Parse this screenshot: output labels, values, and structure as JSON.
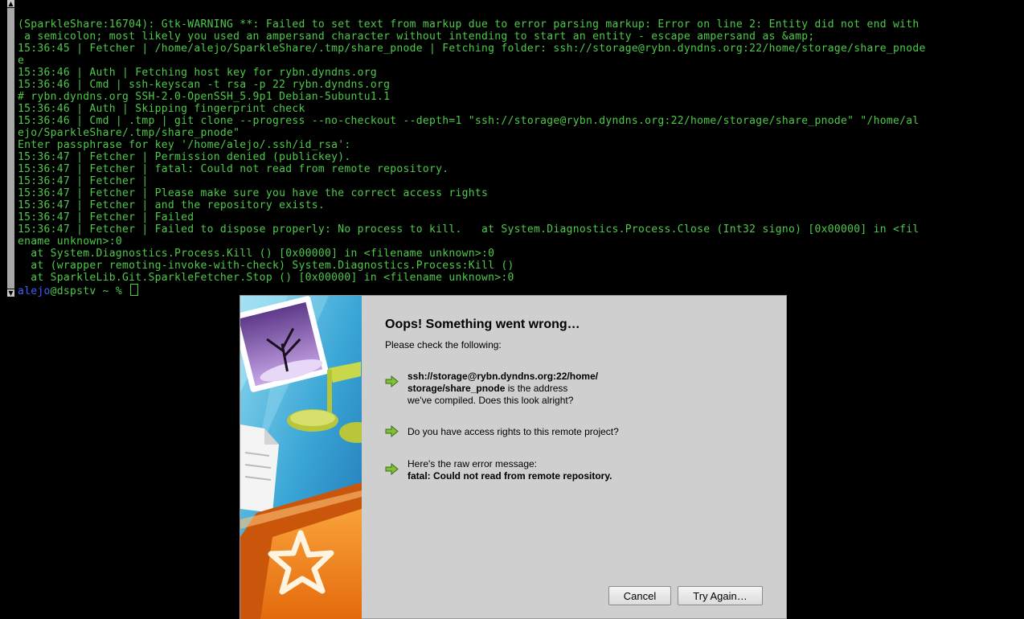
{
  "terminal": {
    "lines": [
      "(SparkleShare:16704): Gtk-WARNING **: Failed to set text from markup due to error parsing markup: Error on line 2: Entity did not end with",
      " a semicolon; most likely you used an ampersand character without intending to start an entity - escape ampersand as &amp;",
      "15:36:45 | Fetcher | /home/alejo/SparkleShare/.tmp/share_pnode | Fetching folder: ssh://storage@rybn.dyndns.org:22/home/storage/share_pnode",
      "e",
      "15:36:46 | Auth | Fetching host key for rybn.dyndns.org",
      "15:36:46 | Cmd | ssh-keyscan -t rsa -p 22 rybn.dyndns.org",
      "# rybn.dyndns.org SSH-2.0-OpenSSH_5.9p1 Debian-5ubuntu1.1",
      "15:36:46 | Auth | Skipping fingerprint check",
      "15:36:46 | Cmd | .tmp | git clone --progress --no-checkout --depth=1 \"ssh://storage@rybn.dyndns.org:22/home/storage/share_pnode\" \"/home/al",
      "ejo/SparkleShare/.tmp/share_pnode\"",
      "Enter passphrase for key '/home/alejo/.ssh/id_rsa':",
      "15:36:47 | Fetcher | Permission denied (publickey).",
      "15:36:47 | Fetcher | fatal: Could not read from remote repository.",
      "15:36:47 | Fetcher |",
      "15:36:47 | Fetcher | Please make sure you have the correct access rights",
      "15:36:47 | Fetcher | and the repository exists.",
      "15:36:47 | Fetcher | Failed",
      "15:36:47 | Fetcher | Failed to dispose properly: No process to kill.   at System.Diagnostics.Process.Close (Int32 signo) [0x00000] in <fil",
      "ename unknown>:0",
      "  at System.Diagnostics.Process.Kill () [0x00000] in <filename unknown>:0",
      "  at (wrapper remoting-invoke-with-check) System.Diagnostics.Process:Kill ()",
      "  at SparkleLib.Git.SparkleFetcher.Stop () [0x00000] in <filename unknown>:0"
    ],
    "prompt_user": "alejo",
    "prompt_rest": "@dspstv ~ % ",
    "colors": {
      "text": "#4ec94a",
      "user": "#3f5fff",
      "background": "#000000"
    }
  },
  "dialog": {
    "title": "Oops! Something went wrong…",
    "subtitle": "Please check the following:",
    "address_bold_1": "ssh://storage@rybn.dyndns.org:22/home/",
    "address_bold_2": "storage/share_pnode",
    "address_rest_1": " is the address",
    "address_rest_2": "we've compiled. Does this look alright?",
    "access_rights": "Do you have access rights to this remote project?",
    "raw_error_label": "Here's the raw error message:",
    "raw_error_message": "fatal: Could not read from remote repository.",
    "cancel_label": "Cancel",
    "try_again_label": "Try Again…",
    "icons": [
      "arrow-right-icon",
      "photo-icon",
      "music-note-icon",
      "document-icon",
      "folder-star-icon"
    ]
  }
}
